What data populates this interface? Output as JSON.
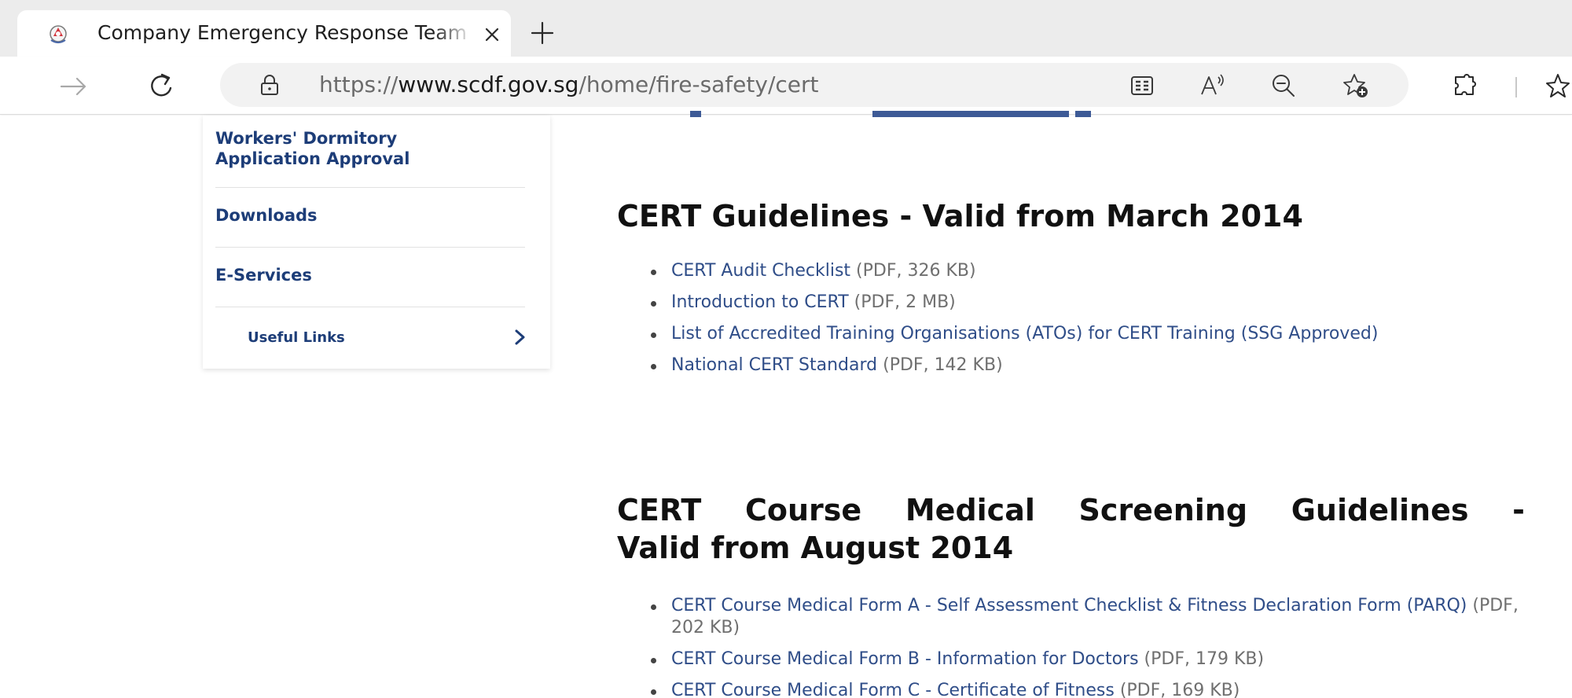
{
  "browser": {
    "tab": {
      "title": "Company Emergency Response Team",
      "favicon": "scdf-crest-icon",
      "close_icon": "close-icon"
    },
    "new_tab_icon": "plus-icon",
    "toolbar": {
      "forward_icon": "arrow-right-icon",
      "refresh_icon": "refresh-icon",
      "lock_icon": "lock-icon",
      "url_prefix": "https://",
      "url_host": "www.scdf.gov.sg",
      "url_path": "/home/fire-safety/cert",
      "icons": [
        "immersive-reader-icon",
        "read-aloud-icon",
        "zoom-out-icon",
        "add-favorite-icon",
        "extensions-icon",
        "favorites-icon"
      ]
    }
  },
  "sidebar": {
    "items": [
      {
        "label": "Workers' Dormitory Application Approval"
      },
      {
        "label": "Downloads"
      },
      {
        "label": "E-Services"
      }
    ],
    "sub_item": {
      "label": "Useful Links",
      "icon": "chevron-right-icon"
    }
  },
  "main": {
    "sections": [
      {
        "heading": "CERT Guidelines - Valid from March 2014",
        "docs": [
          {
            "link": "CERT Audit Checklist",
            "meta": " (PDF, 326 KB)"
          },
          {
            "link": "Introduction to CERT",
            "meta": " (PDF, 2 MB)"
          },
          {
            "link": "List of Accredited Training Organisations (ATOs) for CERT Training (SSG Approved)",
            "meta": ""
          },
          {
            "link": "National CERT Standard",
            "meta": " (PDF, 142 KB)"
          }
        ]
      },
      {
        "heading_line1_words": [
          "CERT",
          "Course",
          "Medical",
          "Screening",
          "Guidelines",
          "-"
        ],
        "heading_line2": "Valid from August 2014",
        "docs": [
          {
            "link": "CERT Course Medical Form A - Self Assessment Checklist & Fitness Declaration Form (PARQ)",
            "meta": " (PDF, 202 KB)"
          },
          {
            "link": "CERT Course Medical Form B - Information for Doctors",
            "meta": " (PDF, 179 KB)"
          },
          {
            "link": "CERT Course Medical Form C - Certificate of Fitness",
            "meta": " (PDF, 169 KB)"
          }
        ]
      }
    ]
  }
}
